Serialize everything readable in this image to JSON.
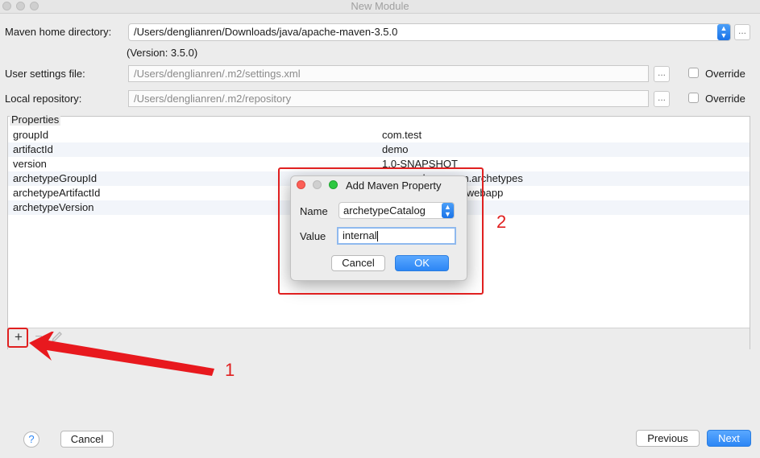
{
  "window": {
    "title": "New Module"
  },
  "maven": {
    "home_label": "Maven home directory:",
    "home_value": "/Users/denglianren/Downloads/java/apache-maven-3.5.0",
    "version_text": "(Version: 3.5.0)",
    "settings_label": "User settings file:",
    "settings_value": "/Users/denglianren/.m2/settings.xml",
    "repo_label": "Local repository:",
    "repo_value": "/Users/denglianren/.m2/repository",
    "browse_label": "...",
    "override_label": "Override"
  },
  "properties": {
    "title": "Properties",
    "rows": [
      {
        "key": "groupId",
        "value": "com.test"
      },
      {
        "key": "artifactId",
        "value": "demo"
      },
      {
        "key": "version",
        "value": "1.0-SNAPSHOT"
      },
      {
        "key": "archetypeGroupId",
        "value": "org.apache.maven.archetypes"
      },
      {
        "key": "archetypeArtifactId",
        "value": "maven-archetype-webapp"
      },
      {
        "key": "archetypeVersion",
        "value": ""
      }
    ],
    "add_symbol": "+",
    "remove_symbol": "−"
  },
  "dialog": {
    "title": "Add Maven Property",
    "name_label": "Name",
    "name_value": "archetypeCatalog",
    "value_label": "Value",
    "value_value": "internal",
    "cancel_label": "Cancel",
    "ok_label": "OK"
  },
  "annotations": {
    "label_1": "1",
    "label_2": "2",
    "color": "#e02020"
  },
  "footer": {
    "help_label": "?",
    "cancel_label": "Cancel",
    "previous_label": "Previous",
    "next_label": "Next"
  }
}
